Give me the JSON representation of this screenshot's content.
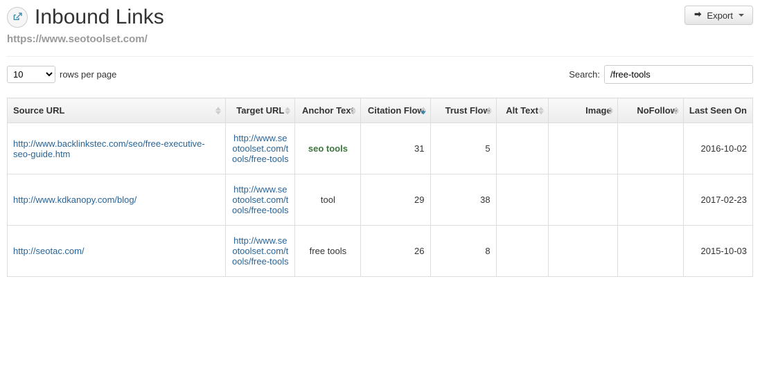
{
  "header": {
    "title": "Inbound Links",
    "export_label": "Export"
  },
  "subtitle": "https://www.seotoolset.com/",
  "controls": {
    "rows_per_page_value": "10",
    "rows_per_page_label": "rows per page",
    "search_label": "Search:",
    "search_value": "/free-tools"
  },
  "table": {
    "columns": {
      "source_url": "Source URL",
      "target_url": "Target URL",
      "anchor_text": "Anchor Text",
      "citation_flow": "Citation Flow",
      "trust_flow": "Trust Flow",
      "alt_text": "Alt Text",
      "image": "Image",
      "nofollow": "NoFollow",
      "last_seen": "Last Seen On"
    },
    "rows": [
      {
        "source_url": "http://www.backlinkstec.com/seo/free-executive-seo-guide.htm",
        "target_url": "http://www.seotoolset.com/tools/free-tools",
        "anchor_text": "seo tools",
        "anchor_highlight": true,
        "citation_flow": "31",
        "trust_flow": "5",
        "alt_text": "",
        "image": "",
        "nofollow": "",
        "last_seen": "2016-10-02"
      },
      {
        "source_url": "http://www.kdkanopy.com/blog/",
        "target_url": "http://www.seotoolset.com/tools/free-tools",
        "anchor_text": "tool",
        "anchor_highlight": false,
        "citation_flow": "29",
        "trust_flow": "38",
        "alt_text": "",
        "image": "",
        "nofollow": "",
        "last_seen": "2017-02-23"
      },
      {
        "source_url": "http://seotac.com/",
        "target_url": "http://www.seotoolset.com/tools/free-tools",
        "anchor_text": "free tools",
        "anchor_highlight": false,
        "citation_flow": "26",
        "trust_flow": "8",
        "alt_text": "",
        "image": "",
        "nofollow": "",
        "last_seen": "2015-10-03"
      }
    ]
  }
}
